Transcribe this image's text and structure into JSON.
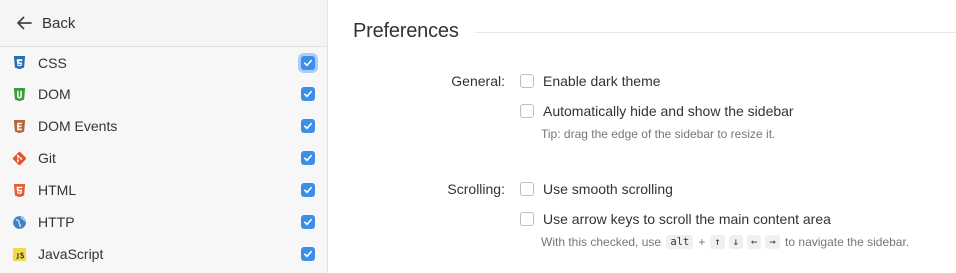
{
  "sidebar": {
    "back_label": "Back",
    "docs": [
      {
        "label": "CSS",
        "icon": "css3-icon",
        "color": "#2a6fb6",
        "checked": true,
        "focused": true
      },
      {
        "label": "DOM",
        "icon": "dom-icon",
        "color": "#3f9a3c",
        "checked": true
      },
      {
        "label": "DOM Events",
        "icon": "dom-events-icon",
        "color": "#b0683a",
        "checked": true
      },
      {
        "label": "Git",
        "icon": "git-icon",
        "color": "#e4522f",
        "checked": true
      },
      {
        "label": "HTML",
        "icon": "html5-icon",
        "color": "#e4602f",
        "checked": true
      },
      {
        "label": "HTTP",
        "icon": "http-globe-icon",
        "color": "#3f80c6",
        "checked": true
      },
      {
        "label": "JavaScript",
        "icon": "javascript-icon",
        "color": "#f0d94a",
        "checked": true
      }
    ]
  },
  "main": {
    "title": "Preferences",
    "general": {
      "label": "General:",
      "dark_theme": "Enable dark theme",
      "auto_hide": "Automatically hide and show the sidebar",
      "tip": "Tip: drag the edge of the sidebar to resize it."
    },
    "scrolling": {
      "label": "Scrolling:",
      "smooth": "Use smooth scrolling",
      "arrow_keys": "Use arrow keys to scroll the main content area",
      "tip_prefix": "With this checked, use",
      "keys": [
        "alt",
        "↑",
        "↓",
        "←",
        "→"
      ],
      "plus": "+",
      "tip_suffix": "to navigate the sidebar."
    }
  },
  "colors": {
    "accent": "#3c8fe8"
  }
}
